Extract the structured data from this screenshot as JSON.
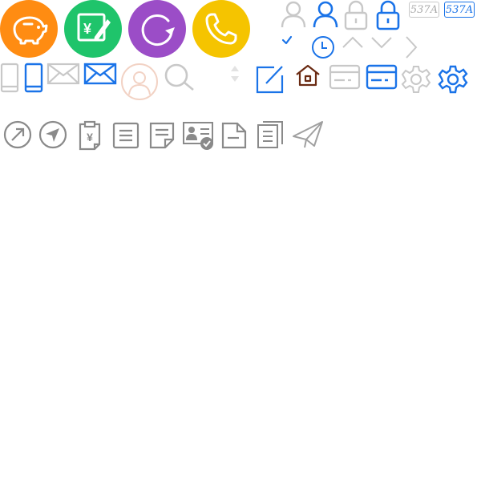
{
  "colors": {
    "orange": "#ff8c12",
    "green": "#1fc46b",
    "purple": "#9b4dc7",
    "yellow": "#f5c400",
    "blue": "#1a73e8",
    "gray": "#c8c8c8",
    "dark_gray": "#8a8a8a",
    "brown": "#6a2a12",
    "peach": "#f2d2c4"
  },
  "row1": {
    "circles": [
      {
        "name": "piggy-bank-icon",
        "color": "#ff8c12"
      },
      {
        "name": "yuan-edit-icon",
        "color": "#1fc46b",
        "glyph": "¥"
      },
      {
        "name": "refresh-icon",
        "color": "#9b4dc7"
      },
      {
        "name": "phone-icon",
        "color": "#f5c400"
      }
    ]
  },
  "captcha": {
    "inactive_text": "537A",
    "active_text": "537A"
  },
  "icons": [
    "user-icon-gray",
    "user-icon-blue",
    "lock-icon-gray",
    "lock-icon-blue",
    "captcha-icon-gray",
    "captcha-icon-blue",
    "check-icon",
    "clock-icon",
    "chevron-up-icon",
    "chevron-down-icon",
    "chevron-right-icon",
    "mobile-icon-gray",
    "mobile-icon-blue",
    "mail-icon-gray",
    "mail-icon-blue",
    "avatar-placeholder-icon",
    "search-icon",
    "sort-icon",
    "edit-icon",
    "home-icon",
    "card-icon-gray",
    "card-icon-blue",
    "gear-icon-gray",
    "gear-icon-blue",
    "arrow-up-right-icon",
    "navigation-icon",
    "clipboard-yuan-icon",
    "document-list-icon",
    "note-icon",
    "id-card-verified-icon",
    "file-icon",
    "files-icon",
    "send-icon"
  ]
}
